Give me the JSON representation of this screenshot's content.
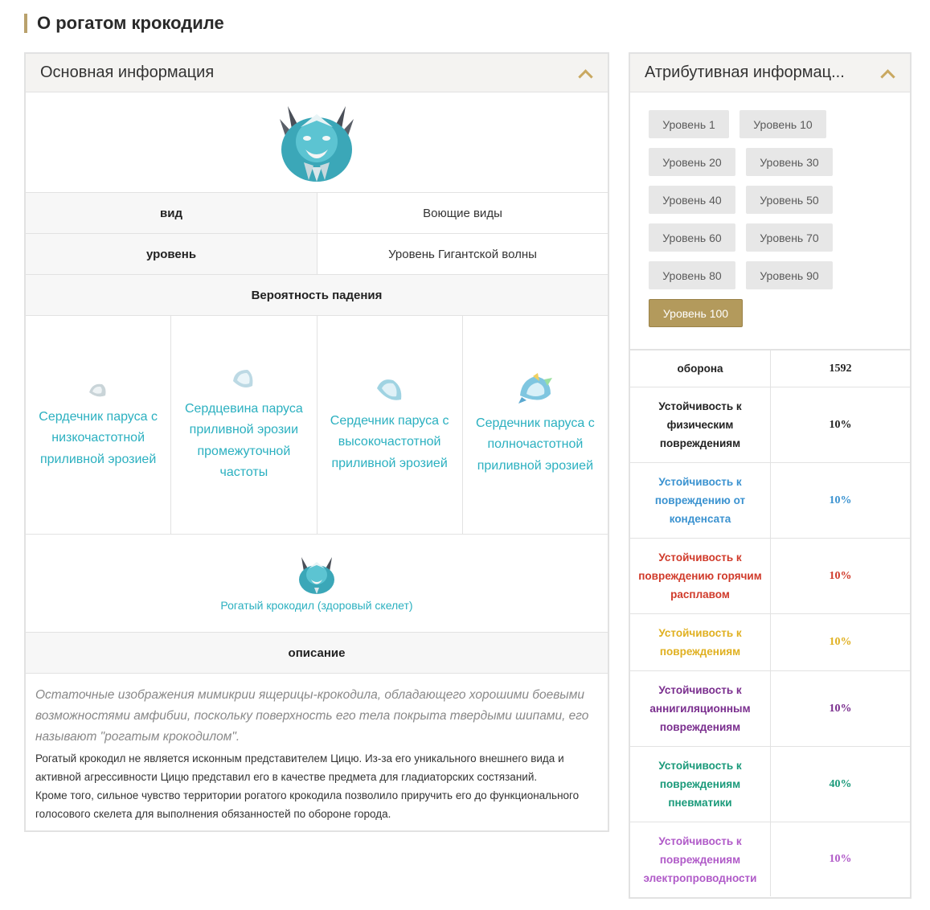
{
  "page": {
    "title": "О рогатом крокодиле"
  },
  "colors": {
    "accent": "#b9a16c",
    "link": "#2bb0c0",
    "active_level": "#b39a5c"
  },
  "main_panel": {
    "title": "Основная информация",
    "collapse_icon": "chevron-up-icon",
    "rows": [
      {
        "label": "вид",
        "value": "Воющие виды"
      },
      {
        "label": "уровень",
        "value": "Уровень Гигантской волны"
      }
    ],
    "drops_title": "Вероятность падения",
    "drops": [
      {
        "name": "Сердечник паруса с низкочастотной приливной эрозией"
      },
      {
        "name": "Сердцевина паруса приливной эрозии промежуточной частоты"
      },
      {
        "name": "Сердечник паруса с высокочастотной приливной эрозией"
      },
      {
        "name": "Сердечник паруса с полночастотной приливной эрозией"
      }
    ],
    "variant": {
      "name": "Рогатый крокодил (здоровый скелет)"
    },
    "description_title": "описание",
    "description_italic": "Остаточные изображения мимикрии ящерицы-крокодила, обладающего хорошими боевыми возможностями амфибии, поскольку поверхность его тела покрыта твердыми шипами, его называют \"рогатым крокодилом\".",
    "description_lines": [
      "Рогатый крокодил не является исконным представителем Цицю. Из-за его уникального внешнего вида и активной агрессивности Цицю представил его в качестве предмета для гладиаторских состязаний.",
      "Кроме того, сильное чувство территории рогатого крокодила позволило приручить его до функционального голосового скелета для выполнения обязанностей по обороне города."
    ]
  },
  "attr_panel": {
    "title": "Атрибутивная информац...",
    "collapse_icon": "chevron-up-icon",
    "levels": [
      "Уровень 1",
      "Уровень 10",
      "Уровень 20",
      "Уровень 30",
      "Уровень 40",
      "Уровень 50",
      "Уровень 60",
      "Уровень 70",
      "Уровень 80",
      "Уровень 90",
      "Уровень 100"
    ],
    "active_level": "Уровень 100",
    "attributes": [
      {
        "label": "оборона",
        "value": "1592",
        "color": "#222222"
      },
      {
        "label": "Устойчивость к физическим повреждениям",
        "value": "10%",
        "color": "#222222"
      },
      {
        "label": "Устойчивость к повреждению от конденсата",
        "value": "10%",
        "color": "#3a92d0"
      },
      {
        "label": "Устойчивость к повреждению горячим расплавом",
        "value": "10%",
        "color": "#d03a2a"
      },
      {
        "label": "Устойчивость к повреждениям",
        "value": "10%",
        "color": "#e0b020"
      },
      {
        "label": "Устойчивость к аннигиляционным повреждениям",
        "value": "10%",
        "color": "#7a2e8e"
      },
      {
        "label": "Устойчивость к повреждениям пневматики",
        "value": "40%",
        "color": "#1a9a7a"
      },
      {
        "label": "Устойчивость к повреждениям электропроводности",
        "value": "10%",
        "color": "#b05ac8"
      }
    ]
  }
}
